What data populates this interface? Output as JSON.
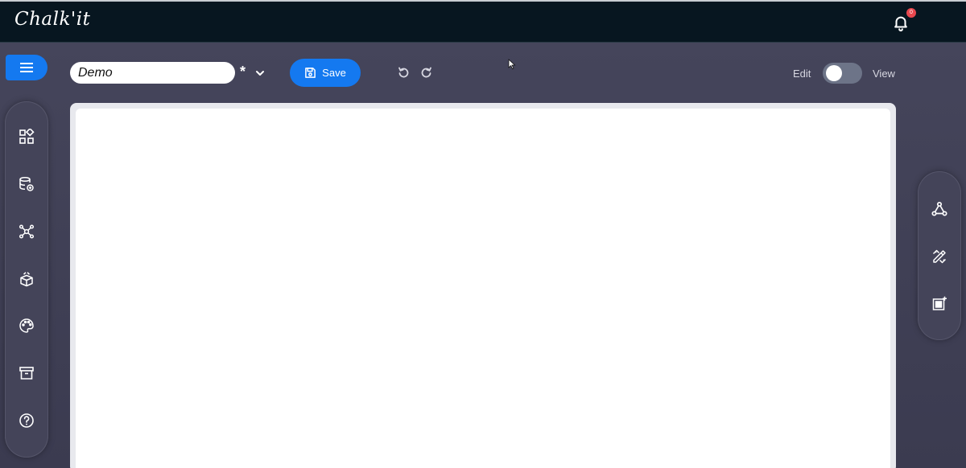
{
  "app": {
    "logo_text": "Chalk'it"
  },
  "notifications": {
    "count": "0"
  },
  "toolbar": {
    "project_name": "Demo",
    "unsaved_indicator": "*",
    "save_label": "Save",
    "edit_label": "Edit",
    "view_label": "View"
  },
  "left_sidebar": {
    "items": [
      {
        "icon": "widgets-icon"
      },
      {
        "icon": "datasource-icon"
      },
      {
        "icon": "graph-icon"
      },
      {
        "icon": "libraries-icon"
      },
      {
        "icon": "palette-icon"
      },
      {
        "icon": "archive-icon"
      },
      {
        "icon": "help-icon"
      }
    ]
  },
  "right_sidebar": {
    "items": [
      {
        "icon": "connections-icon"
      },
      {
        "icon": "design-tools-icon"
      },
      {
        "icon": "aspect-icon"
      }
    ]
  },
  "colors": {
    "topbar": "#071620",
    "background": "#3d3d52",
    "accent": "#1479f0",
    "badge": "#e8484f"
  }
}
